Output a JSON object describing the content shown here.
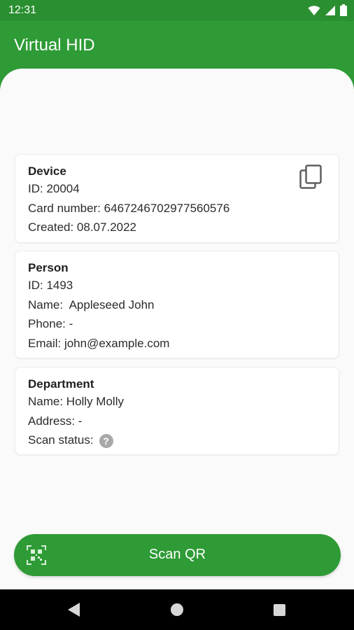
{
  "status_bar": {
    "time": "12:31"
  },
  "app_bar": {
    "title": "Virtual HID"
  },
  "device": {
    "title": "Device",
    "id": "ID: 20004",
    "card_number": "Card number: 6467246702977560576",
    "created": "Created: 08.07.2022"
  },
  "person": {
    "title": "Person",
    "id": "ID: 1493",
    "name": "Name:  Appleseed John",
    "phone": "Phone: -",
    "email": "Email: john@example.com"
  },
  "department": {
    "title": "Department",
    "name": "Name: Holly Molly",
    "address": "Address: -",
    "scan_status": "Scan status:",
    "scan_status_badge": "?"
  },
  "scan_button": {
    "label": "Scan QR"
  },
  "colors": {
    "primary": "#2e9b36",
    "status_bar": "#2a8f31",
    "background": "#fafafa"
  },
  "icons": {
    "copy": "copy-icon",
    "qr": "qr-code-icon",
    "wifi": "wifi-icon",
    "signal": "signal-icon",
    "battery": "battery-icon"
  }
}
